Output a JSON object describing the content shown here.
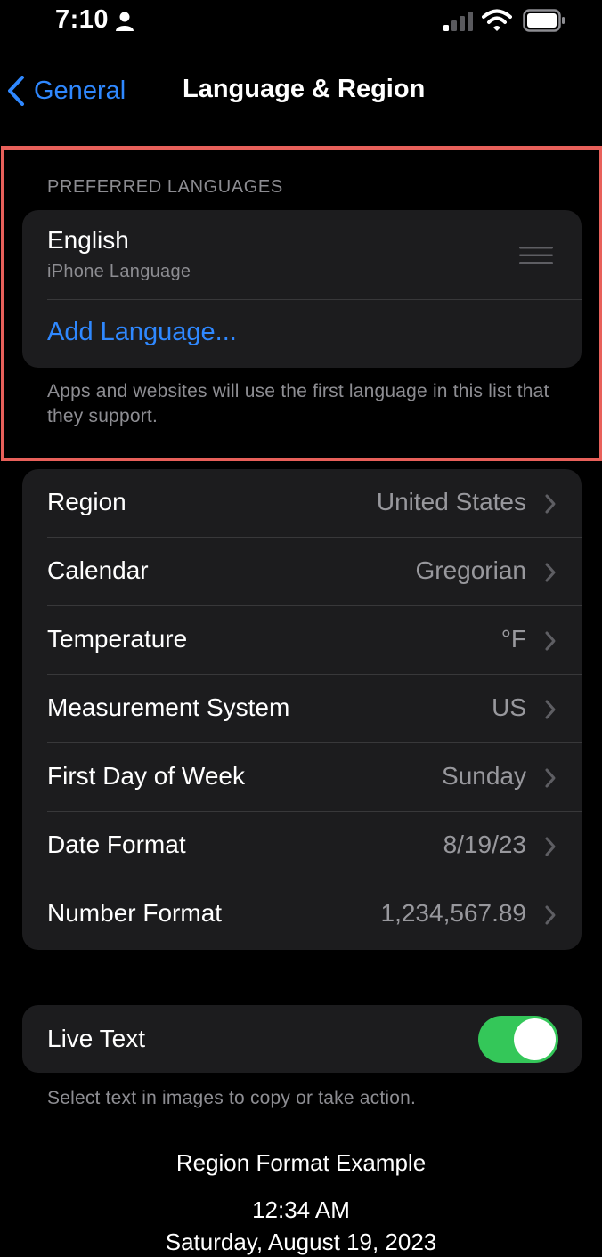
{
  "status_bar": {
    "time": "7:10",
    "icons": [
      "person-icon",
      "cellular-signal-icon",
      "wifi-icon",
      "battery-icon"
    ]
  },
  "nav": {
    "back_label": "General",
    "title": "Language & Region"
  },
  "preferred_languages": {
    "header": "PREFERRED LANGUAGES",
    "languages": [
      {
        "name": "English",
        "subtitle": "iPhone Language"
      }
    ],
    "add_label": "Add Language...",
    "footer": "Apps and websites will use the first language in this list that they support."
  },
  "settings": {
    "rows": [
      {
        "label": "Region",
        "value": "United States"
      },
      {
        "label": "Calendar",
        "value": "Gregorian"
      },
      {
        "label": "Temperature",
        "value": "°F"
      },
      {
        "label": "Measurement System",
        "value": "US"
      },
      {
        "label": "First Day of Week",
        "value": "Sunday"
      },
      {
        "label": "Date Format",
        "value": "8/19/23"
      },
      {
        "label": "Number Format",
        "value": "1,234,567.89"
      }
    ]
  },
  "live_text": {
    "label": "Live Text",
    "enabled": true,
    "footer": "Select text in images to copy or take action."
  },
  "region_example": {
    "title": "Region Format Example",
    "time": "12:34 AM",
    "date": "Saturday, August 19, 2023"
  },
  "colors": {
    "accent": "#2f88ff",
    "highlight_border": "#e8605a",
    "toggle_on": "#34c759",
    "card_bg": "#1c1c1e"
  }
}
